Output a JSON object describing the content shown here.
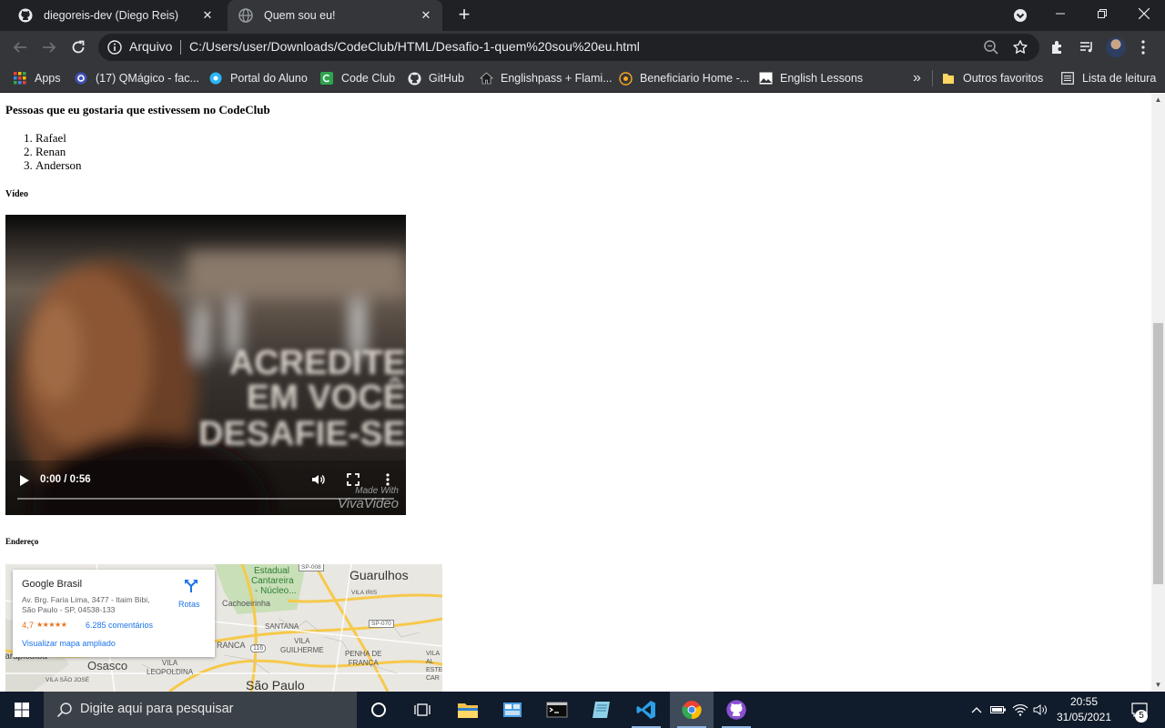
{
  "browser": {
    "tabs": [
      {
        "title": "diegoreis-dev (Diego Reis)",
        "favicon": "github-icon",
        "active": false
      },
      {
        "title": "Quem sou eu!",
        "favicon": "globe-icon",
        "active": true
      }
    ],
    "omnibox": {
      "chip": "Arquivo",
      "url": "C:/Users/user/Downloads/CodeClub/HTML/Desafio-1-quem%20sou%20eu.html"
    },
    "bookmarks": [
      {
        "label": "Apps",
        "icon": "apps-grid-icon"
      },
      {
        "label": "(17) QMágico - fac...",
        "icon": "qmagico-icon"
      },
      {
        "label": "Portal do Aluno",
        "icon": "portal-icon"
      },
      {
        "label": "Code Club",
        "icon": "codeclub-icon"
      },
      {
        "label": "GitHub",
        "icon": "github-icon"
      },
      {
        "label": "Englishpass + Flami...",
        "icon": "home-icon"
      },
      {
        "label": "Beneficiario Home -...",
        "icon": "beneficiario-icon"
      },
      {
        "label": "English Lessons",
        "icon": "english-lessons-icon"
      }
    ],
    "other_bookmarks": "Outros favoritos",
    "reading_list": "Lista de leitura",
    "more_bookmarks": "»"
  },
  "page": {
    "friends_title": "Pessoas que eu gostaria que estivessem no CodeClub",
    "friends": [
      {
        "num": "1.",
        "name": "Rafael"
      },
      {
        "num": "2.",
        "name": "Renan"
      },
      {
        "num": "3.",
        "name": "Anderson"
      }
    ],
    "video_title": "Vídeo",
    "video": {
      "time": "0:00 / 0:56",
      "progress": 0,
      "overlay_lines": [
        "ACREDITE",
        "EM VOCÊ",
        "DESAFIE-SE"
      ],
      "watermark_line1": "Made With",
      "watermark_line2": "VivaVideo"
    },
    "address_title": "Endereço",
    "map": {
      "place_name": "Google Brasil",
      "address_line1": "Av. Brg. Faria Lima, 3477 - Itaim Bibi,",
      "address_line2": "São Paulo - SP, 04538-133",
      "rating": "4,7",
      "stars": "★★★★★",
      "reviews": "6.285 comentários",
      "directions": "Rotas",
      "view_larger": "Visualizar mapa ampliado",
      "labels": {
        "guarulhos": "Guarulhos",
        "estadual": "Estadual",
        "cantareira": "Cantareira",
        "nucleo": "- Núcleo...",
        "cachoeirinha": "Cachoeirinha",
        "vila_iris": "VILA IRIS",
        "santana": "SANTANA",
        "vila_guilherme": "VILA\nGUILHERME",
        "penha": "PENHA DE\nFRANÇA",
        "osasco": "Osasco",
        "vila_leopoldina": "VILA\nLEOPOLDINA",
        "sao_paulo": "São Paulo",
        "vila_sao_jose": "VILA SÃO JOSÉ",
        "carapicuiba": "Carapicuíba",
        "franca": "RANCA",
        "sp008": "SP-008",
        "sp070": "SP-070",
        "br116": "116",
        "vila_alpina": "VILA\nAL\nESTE\nCAR"
      }
    }
  },
  "taskbar": {
    "search_placeholder": "Digite aqui para pesquisar",
    "time": "20:55",
    "date": "31/05/2021",
    "notifications": "5"
  },
  "colors": {
    "tab_bg": "#202124",
    "toolbar_bg": "#35363a",
    "taskbar_bg": "#101b2b",
    "link": "#1a73e8",
    "rating": "#e7711b"
  }
}
